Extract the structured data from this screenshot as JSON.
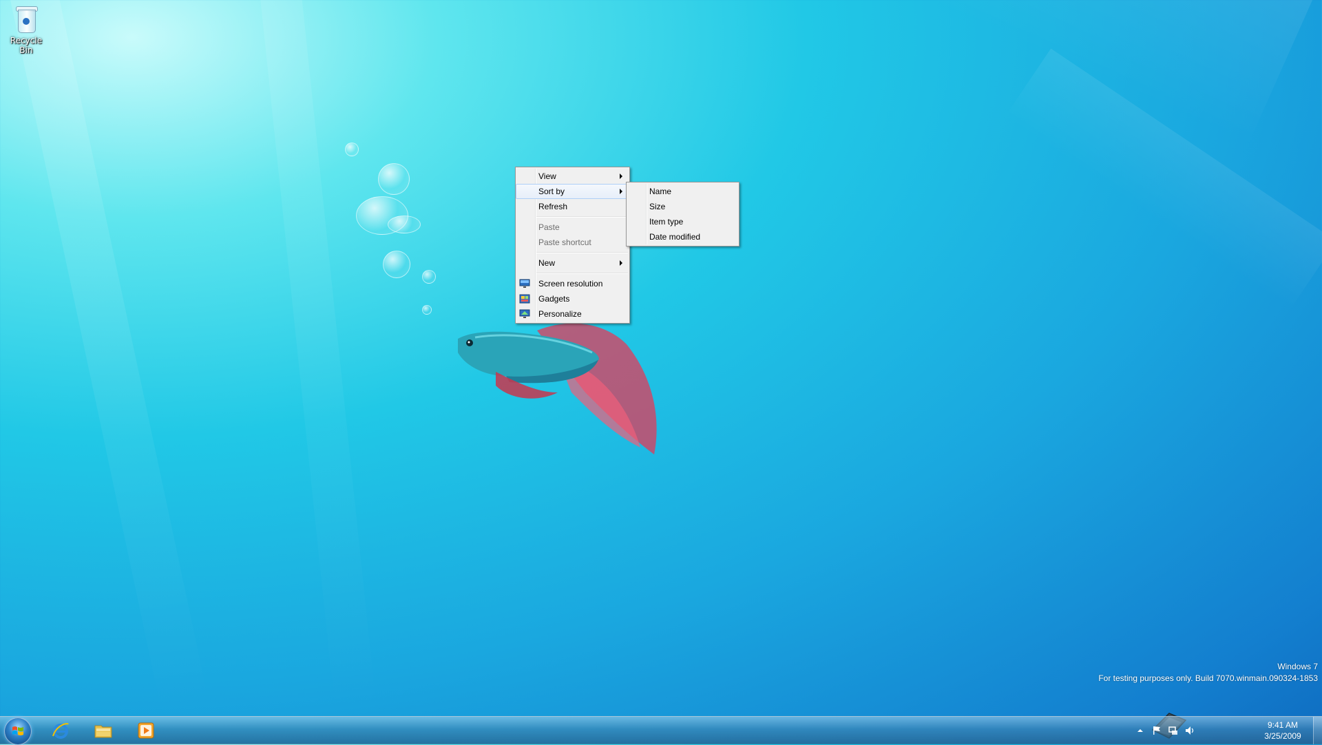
{
  "desktop": {
    "icons": [
      {
        "label": "Recycle Bin",
        "icon": "recycle-bin-icon"
      }
    ],
    "watermark": {
      "line1": "Windows 7",
      "line2": "For testing purposes only. Build 7070.winmain.090324-1853"
    }
  },
  "context_menu": {
    "items": [
      {
        "label": "View",
        "submenu": true
      },
      {
        "label": "Sort by",
        "submenu": true,
        "highlighted": true
      },
      {
        "label": "Refresh"
      },
      {
        "label": "Paste",
        "disabled": true
      },
      {
        "label": "Paste shortcut",
        "disabled": true
      },
      {
        "label": "New",
        "submenu": true
      },
      {
        "label": "Screen resolution",
        "icon": "screen-resolution-icon"
      },
      {
        "label": "Gadgets",
        "icon": "gadgets-icon"
      },
      {
        "label": "Personalize",
        "icon": "personalize-icon"
      }
    ]
  },
  "sort_submenu": {
    "items": [
      {
        "label": "Name"
      },
      {
        "label": "Size"
      },
      {
        "label": "Item type"
      },
      {
        "label": "Date modified"
      }
    ]
  },
  "taskbar": {
    "start_button": "start-orb-icon",
    "pinned": [
      {
        "app": "internet-explorer-icon"
      },
      {
        "app": "windows-explorer-icon"
      },
      {
        "app": "windows-media-player-icon"
      }
    ],
    "tray": {
      "icons": [
        "show-hidden-icons-arrow",
        "action-center-flag-icon",
        "network-icon",
        "volume-icon"
      ],
      "time": "9:41 AM",
      "date": "3/25/2009"
    }
  },
  "colors": {
    "menu_bg": "#f0f0f0",
    "menu_border": "#979797",
    "highlight": "#aecff7",
    "disabled_text": "#6d6d6d"
  }
}
